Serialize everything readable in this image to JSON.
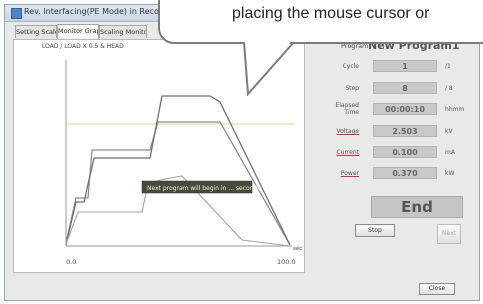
{
  "window": {
    "title": "Rev. Interfacing(PE Mode) in Recording"
  },
  "tabs": [
    {
      "label": "Setting Scale"
    },
    {
      "label": "Monitor Graph"
    },
    {
      "label": "Scaling Monitor Gra"
    }
  ],
  "graph": {
    "ylabel": "LOAD / LOAD X 0.5 & HEAD",
    "x_start": "0.0",
    "x_end": "100.0",
    "x_unit": "sec",
    "annotation": "Next program will begin in ... seconds"
  },
  "program_header": {
    "label": "Program",
    "value": "New Program1"
  },
  "rows": [
    {
      "label": "Cycle",
      "value": "1",
      "unit": "/1"
    },
    {
      "label": "Step",
      "value": "8",
      "unit": "/ 8"
    },
    {
      "label": "Elapsed Time",
      "value": "00:00:10",
      "unit": "hhmm"
    },
    {
      "label": "Voltage",
      "value": "2.503",
      "unit": "kV"
    },
    {
      "label": "Current",
      "value": "0.100",
      "unit": "mA"
    },
    {
      "label": "Power",
      "value": "0.370",
      "unit": "kW"
    }
  ],
  "status": {
    "end_label": "End"
  },
  "buttons": {
    "stop": "Stop",
    "next": "Next",
    "close": "Close"
  },
  "callout": {
    "text": "placing the mouse cursor or"
  },
  "colors": {
    "line_gray": "#8d8d8d",
    "line_dark": "#6f6f6f",
    "line_yellow": "#e4cf90"
  }
}
